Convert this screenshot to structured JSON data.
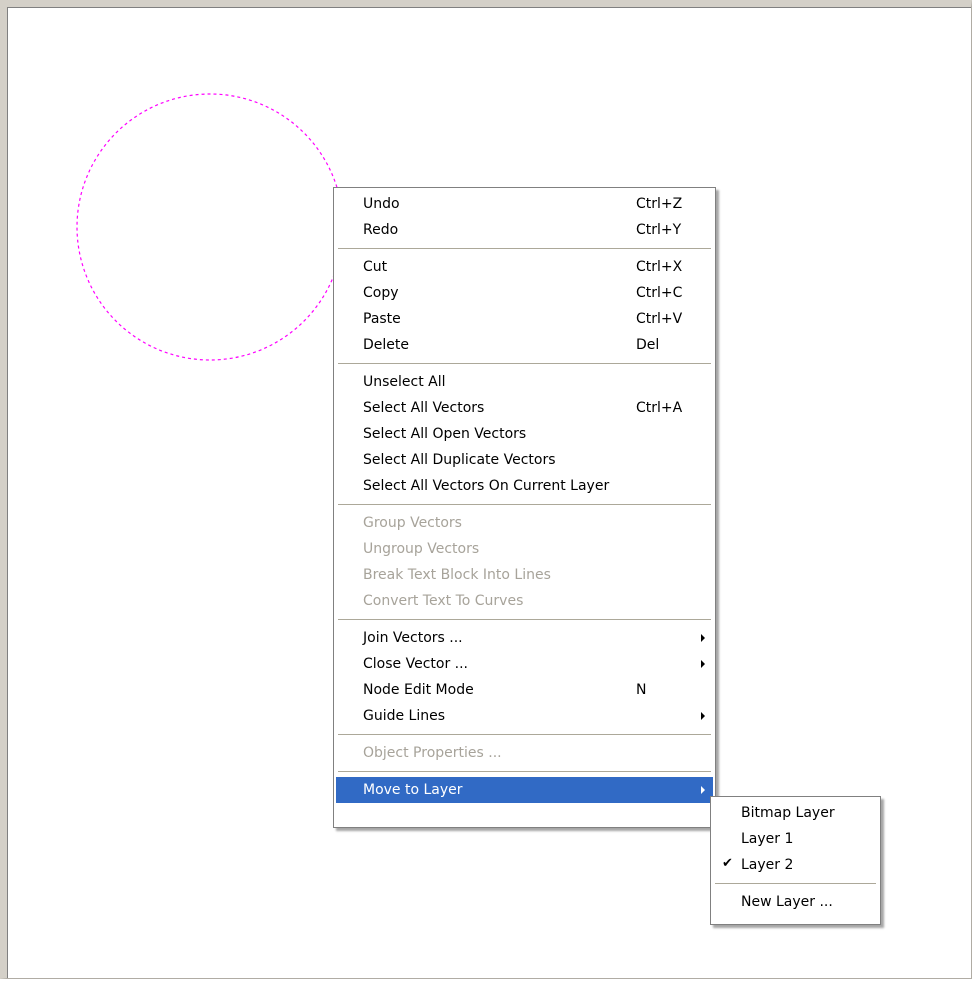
{
  "canvas": {
    "selection_color": "#ff00ff"
  },
  "context_menu": {
    "highlight_color": "#316ac5",
    "groups": [
      [
        {
          "label": "Undo",
          "shortcut": "Ctrl+Z"
        },
        {
          "label": "Redo",
          "shortcut": "Ctrl+Y"
        }
      ],
      [
        {
          "label": "Cut",
          "shortcut": "Ctrl+X"
        },
        {
          "label": "Copy",
          "shortcut": "Ctrl+C"
        },
        {
          "label": "Paste",
          "shortcut": "Ctrl+V"
        },
        {
          "label": "Delete",
          "shortcut": "Del"
        }
      ],
      [
        {
          "label": "Unselect All",
          "shortcut": ""
        },
        {
          "label": "Select All Vectors",
          "shortcut": "Ctrl+A"
        },
        {
          "label": "Select All Open Vectors",
          "shortcut": ""
        },
        {
          "label": "Select All Duplicate Vectors",
          "shortcut": ""
        },
        {
          "label": "Select All Vectors On Current Layer",
          "shortcut": ""
        }
      ],
      [
        {
          "label": "Group Vectors",
          "disabled": true
        },
        {
          "label": "Ungroup Vectors",
          "disabled": true
        },
        {
          "label": "Break Text Block Into Lines",
          "disabled": true
        },
        {
          "label": "Convert Text To Curves",
          "disabled": true
        }
      ],
      [
        {
          "label": "Join Vectors ...",
          "submenu": true
        },
        {
          "label": "Close Vector ...",
          "submenu": true
        },
        {
          "label": "Node Edit Mode",
          "shortcut": "N"
        },
        {
          "label": "Guide Lines",
          "submenu": true
        }
      ],
      [
        {
          "label": "Object Properties ...",
          "disabled": true
        }
      ],
      [
        {
          "label": "Move to Layer",
          "submenu": true,
          "highlighted": true
        }
      ]
    ]
  },
  "layer_submenu": {
    "items": [
      {
        "label": "Bitmap Layer",
        "checked": false
      },
      {
        "label": "Layer 1",
        "checked": false
      },
      {
        "label": "Layer 2",
        "checked": true
      }
    ],
    "check_glyph": "✔",
    "new_layer_label": "New Layer ..."
  }
}
